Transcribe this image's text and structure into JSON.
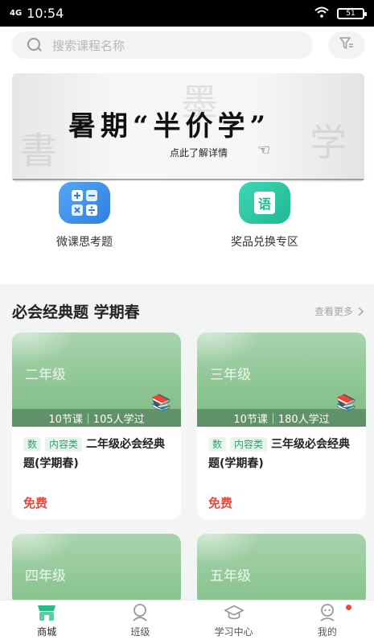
{
  "status_bar": {
    "network": "4G",
    "time": "10:54",
    "battery": "51"
  },
  "search": {
    "placeholder": "搜索课程名称"
  },
  "banner": {
    "title": "暑期“半价学”",
    "subtitle": "点此了解详情"
  },
  "shortcuts": [
    {
      "label": "微课思考题",
      "icon": "math-symbols-icon",
      "color": "#3a8de8"
    },
    {
      "label": "奖品兑换专区",
      "icon": "chinese-yu-icon",
      "icon_text": "语",
      "color": "#27c3a0"
    }
  ],
  "section": {
    "title": "必会经典题 学期春",
    "see_more": "查看更多"
  },
  "courses": [
    {
      "grade": "二年级",
      "meta": "10节课｜105人学过",
      "tags": [
        "数",
        "内容类"
      ],
      "title": "二年级必会经典题(学期春)",
      "price": "免费"
    },
    {
      "grade": "三年级",
      "meta": "10节课｜180人学过",
      "tags": [
        "数",
        "内容类"
      ],
      "title": "三年级必会经典题(学期春)",
      "price": "免费"
    },
    {
      "grade": "四年级"
    },
    {
      "grade": "五年级"
    }
  ],
  "tabs": [
    {
      "label": "商城",
      "icon": "store-icon",
      "active": true
    },
    {
      "label": "班级",
      "icon": "class-icon",
      "active": false
    },
    {
      "label": "学习中心",
      "icon": "graduation-cap-icon",
      "active": false
    },
    {
      "label": "我的",
      "icon": "profile-icon",
      "active": false,
      "badge": true
    }
  ],
  "colors": {
    "accent_green": "#35a06a",
    "price_red": "#e34a3f",
    "tab_active": "#2bb98a"
  }
}
